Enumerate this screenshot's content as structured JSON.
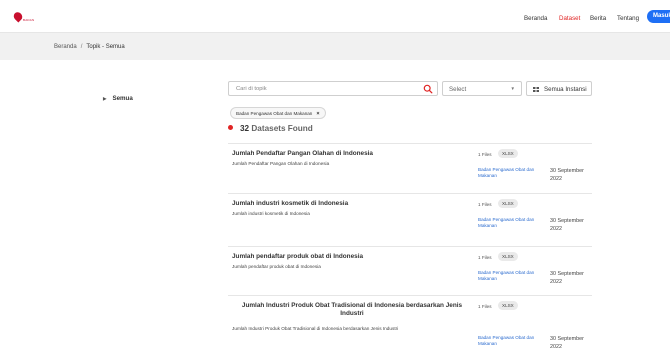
{
  "brand": {
    "logo_text": "BADAN"
  },
  "nav": {
    "items": [
      "Beranda",
      "Dataset",
      "Berita",
      "Tentang"
    ],
    "active": "Dataset",
    "login": "Masuk"
  },
  "breadcrumb": {
    "home": "Beranda",
    "sep": "/",
    "current": "Topik - Semua"
  },
  "sidebar": {
    "arrow": "▶",
    "label": "Semua"
  },
  "search": {
    "placeholder": "Cari di topik"
  },
  "filter": {
    "select_value": "Select",
    "instansi_label": "Semua Instansi"
  },
  "active_filter": {
    "label": "Badan Pengawas Obat dan Makanan",
    "remove": "×"
  },
  "results": {
    "count": "32",
    "label": "Datasets Found"
  },
  "datasets": [
    {
      "title": "Jumlah Pendaftar Pangan Olahan di Indonesia",
      "description": "Jumlah Pendaftar Pangan Olahan di Indonesia",
      "files": "1 Files",
      "format": "XLSX",
      "organization": "Badan Pengawas Obat dan Makanan",
      "date": "30 September 2022"
    },
    {
      "title": "Jumlah industri kosmetik di Indonesia",
      "description": "Jumlah industri kosmetik di Indonesia",
      "files": "1 Files",
      "format": "XLSX",
      "organization": "Badan Pengawas Obat dan Makanan",
      "date": "30 September 2022"
    },
    {
      "title": "Jumlah pendaftar produk obat di Indonesia",
      "description": "Jumlah pendaftar produk obat di Indonesia",
      "files": "1 Files",
      "format": "XLSX",
      "organization": "Badan Pengawas Obat dan Makanan",
      "date": "30 September 2022"
    },
    {
      "title": "Jumlah Industri Produk Obat Tradisional di Indonesia berdasarkan Jenis Industri",
      "description": "Jumlah Industri Produk Obat Tradisional di Indonesia berdasarkan Jenis Industri",
      "files": "1 Files",
      "format": "XLSX",
      "organization": "Badan Pengawas Obat dan Makanan",
      "date": "30 September 2022"
    }
  ]
}
